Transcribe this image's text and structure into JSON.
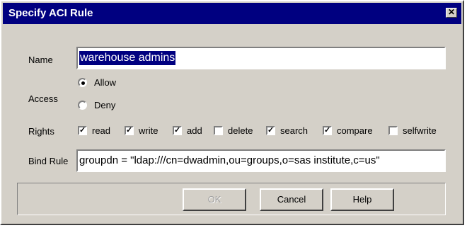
{
  "window": {
    "title": "Specify ACI Rule",
    "close_glyph": "✕"
  },
  "name": {
    "label": "Name",
    "value": "warehouse admins"
  },
  "access": {
    "label": "Access",
    "options": [
      {
        "label": "Allow",
        "selected": true
      },
      {
        "label": "Deny",
        "selected": false
      }
    ]
  },
  "rights": {
    "label": "Rights",
    "items": [
      {
        "label": "read",
        "checked": true
      },
      {
        "label": "write",
        "checked": true
      },
      {
        "label": "add",
        "checked": true
      },
      {
        "label": "delete",
        "checked": false
      },
      {
        "label": "search",
        "checked": true
      },
      {
        "label": "compare",
        "checked": true
      },
      {
        "label": "selfwrite",
        "checked": false
      }
    ]
  },
  "bind_rule": {
    "label": "Bind Rule",
    "value": "groupdn = \"ldap:///cn=dwadmin,ou=groups,o=sas institute,c=us\""
  },
  "buttons": {
    "ok": "OK",
    "cancel": "Cancel",
    "help": "Help"
  },
  "check_glyph": "✓"
}
